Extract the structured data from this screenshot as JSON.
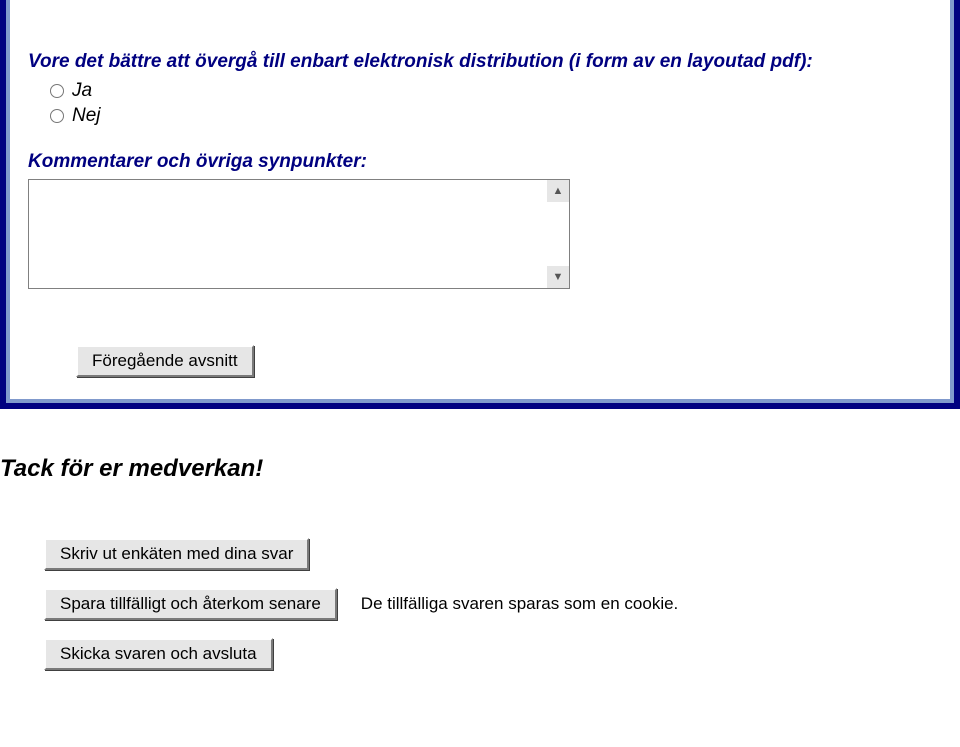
{
  "question": {
    "text": "Vore det bättre att övergå till enbart elektronisk distribution (i form av en layoutad pdf):",
    "options": {
      "yes": "Ja",
      "no": "Nej"
    }
  },
  "comments": {
    "label": "Kommentarer och övriga synpunkter:",
    "value": ""
  },
  "buttons": {
    "previous": "Föregående avsnitt",
    "print": "Skriv ut enkäten med dina svar",
    "save": "Spara tillfälligt och återkom senare",
    "submit": "Skicka svaren och avsluta"
  },
  "thanks": "Tack för er medverkan!",
  "cookie_note": "De tillfälliga svaren sparas som en cookie.",
  "icons": {
    "up": "▲",
    "down": "▼"
  }
}
